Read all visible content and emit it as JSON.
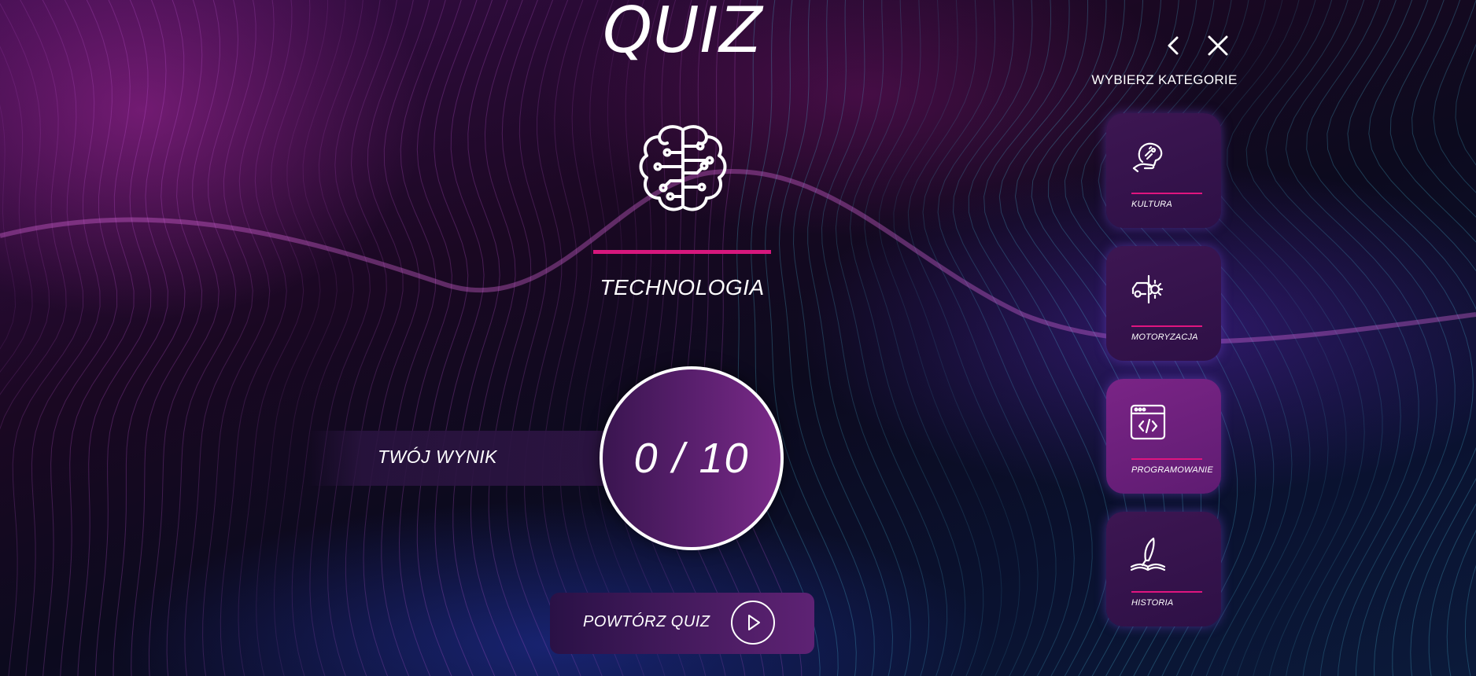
{
  "title": "QUIZ",
  "current_category": {
    "name": "TECHNOLOGIA",
    "icon": "brain-circuit-icon"
  },
  "score": {
    "label": "TWÓJ WYNIK",
    "value": "0 / 10",
    "correct": 0,
    "total": 10
  },
  "repeat_button": {
    "label": "POWTÓRZ QUIZ",
    "icon": "play-icon"
  },
  "nav": {
    "back_icon": "chevron-left-icon",
    "close_icon": "close-icon"
  },
  "sidebar": {
    "heading": "WYBIERZ KATEGORIE",
    "categories": [
      {
        "label": "KULTURA",
        "icon": "culture-head-icon",
        "active": false
      },
      {
        "label": "MOTORYZACJA",
        "icon": "car-gear-icon",
        "active": false
      },
      {
        "label": "PROGRAMOWANIE",
        "icon": "code-window-icon",
        "active": true
      },
      {
        "label": "HISTORIA",
        "icon": "quill-book-icon",
        "active": false
      }
    ]
  },
  "colors": {
    "accent": "#d6177d",
    "active_card": "#7a2486",
    "card": "#3d1652"
  }
}
